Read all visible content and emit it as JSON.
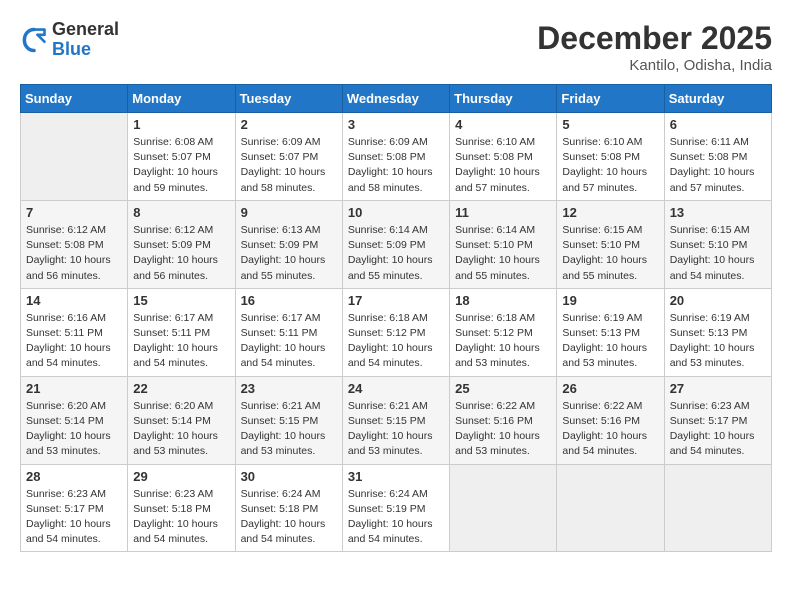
{
  "header": {
    "logo_general": "General",
    "logo_blue": "Blue",
    "month": "December 2025",
    "location": "Kantilo, Odisha, India"
  },
  "columns": [
    "Sunday",
    "Monday",
    "Tuesday",
    "Wednesday",
    "Thursday",
    "Friday",
    "Saturday"
  ],
  "weeks": [
    [
      {
        "day": "",
        "info": ""
      },
      {
        "day": "1",
        "info": "Sunrise: 6:08 AM\nSunset: 5:07 PM\nDaylight: 10 hours\nand 59 minutes."
      },
      {
        "day": "2",
        "info": "Sunrise: 6:09 AM\nSunset: 5:07 PM\nDaylight: 10 hours\nand 58 minutes."
      },
      {
        "day": "3",
        "info": "Sunrise: 6:09 AM\nSunset: 5:08 PM\nDaylight: 10 hours\nand 58 minutes."
      },
      {
        "day": "4",
        "info": "Sunrise: 6:10 AM\nSunset: 5:08 PM\nDaylight: 10 hours\nand 57 minutes."
      },
      {
        "day": "5",
        "info": "Sunrise: 6:10 AM\nSunset: 5:08 PM\nDaylight: 10 hours\nand 57 minutes."
      },
      {
        "day": "6",
        "info": "Sunrise: 6:11 AM\nSunset: 5:08 PM\nDaylight: 10 hours\nand 57 minutes."
      }
    ],
    [
      {
        "day": "7",
        "info": "Sunrise: 6:12 AM\nSunset: 5:08 PM\nDaylight: 10 hours\nand 56 minutes."
      },
      {
        "day": "8",
        "info": "Sunrise: 6:12 AM\nSunset: 5:09 PM\nDaylight: 10 hours\nand 56 minutes."
      },
      {
        "day": "9",
        "info": "Sunrise: 6:13 AM\nSunset: 5:09 PM\nDaylight: 10 hours\nand 55 minutes."
      },
      {
        "day": "10",
        "info": "Sunrise: 6:14 AM\nSunset: 5:09 PM\nDaylight: 10 hours\nand 55 minutes."
      },
      {
        "day": "11",
        "info": "Sunrise: 6:14 AM\nSunset: 5:10 PM\nDaylight: 10 hours\nand 55 minutes."
      },
      {
        "day": "12",
        "info": "Sunrise: 6:15 AM\nSunset: 5:10 PM\nDaylight: 10 hours\nand 55 minutes."
      },
      {
        "day": "13",
        "info": "Sunrise: 6:15 AM\nSunset: 5:10 PM\nDaylight: 10 hours\nand 54 minutes."
      }
    ],
    [
      {
        "day": "14",
        "info": "Sunrise: 6:16 AM\nSunset: 5:11 PM\nDaylight: 10 hours\nand 54 minutes."
      },
      {
        "day": "15",
        "info": "Sunrise: 6:17 AM\nSunset: 5:11 PM\nDaylight: 10 hours\nand 54 minutes."
      },
      {
        "day": "16",
        "info": "Sunrise: 6:17 AM\nSunset: 5:11 PM\nDaylight: 10 hours\nand 54 minutes."
      },
      {
        "day": "17",
        "info": "Sunrise: 6:18 AM\nSunset: 5:12 PM\nDaylight: 10 hours\nand 54 minutes."
      },
      {
        "day": "18",
        "info": "Sunrise: 6:18 AM\nSunset: 5:12 PM\nDaylight: 10 hours\nand 53 minutes."
      },
      {
        "day": "19",
        "info": "Sunrise: 6:19 AM\nSunset: 5:13 PM\nDaylight: 10 hours\nand 53 minutes."
      },
      {
        "day": "20",
        "info": "Sunrise: 6:19 AM\nSunset: 5:13 PM\nDaylight: 10 hours\nand 53 minutes."
      }
    ],
    [
      {
        "day": "21",
        "info": "Sunrise: 6:20 AM\nSunset: 5:14 PM\nDaylight: 10 hours\nand 53 minutes."
      },
      {
        "day": "22",
        "info": "Sunrise: 6:20 AM\nSunset: 5:14 PM\nDaylight: 10 hours\nand 53 minutes."
      },
      {
        "day": "23",
        "info": "Sunrise: 6:21 AM\nSunset: 5:15 PM\nDaylight: 10 hours\nand 53 minutes."
      },
      {
        "day": "24",
        "info": "Sunrise: 6:21 AM\nSunset: 5:15 PM\nDaylight: 10 hours\nand 53 minutes."
      },
      {
        "day": "25",
        "info": "Sunrise: 6:22 AM\nSunset: 5:16 PM\nDaylight: 10 hours\nand 53 minutes."
      },
      {
        "day": "26",
        "info": "Sunrise: 6:22 AM\nSunset: 5:16 PM\nDaylight: 10 hours\nand 54 minutes."
      },
      {
        "day": "27",
        "info": "Sunrise: 6:23 AM\nSunset: 5:17 PM\nDaylight: 10 hours\nand 54 minutes."
      }
    ],
    [
      {
        "day": "28",
        "info": "Sunrise: 6:23 AM\nSunset: 5:17 PM\nDaylight: 10 hours\nand 54 minutes."
      },
      {
        "day": "29",
        "info": "Sunrise: 6:23 AM\nSunset: 5:18 PM\nDaylight: 10 hours\nand 54 minutes."
      },
      {
        "day": "30",
        "info": "Sunrise: 6:24 AM\nSunset: 5:18 PM\nDaylight: 10 hours\nand 54 minutes."
      },
      {
        "day": "31",
        "info": "Sunrise: 6:24 AM\nSunset: 5:19 PM\nDaylight: 10 hours\nand 54 minutes."
      },
      {
        "day": "",
        "info": ""
      },
      {
        "day": "",
        "info": ""
      },
      {
        "day": "",
        "info": ""
      }
    ]
  ]
}
